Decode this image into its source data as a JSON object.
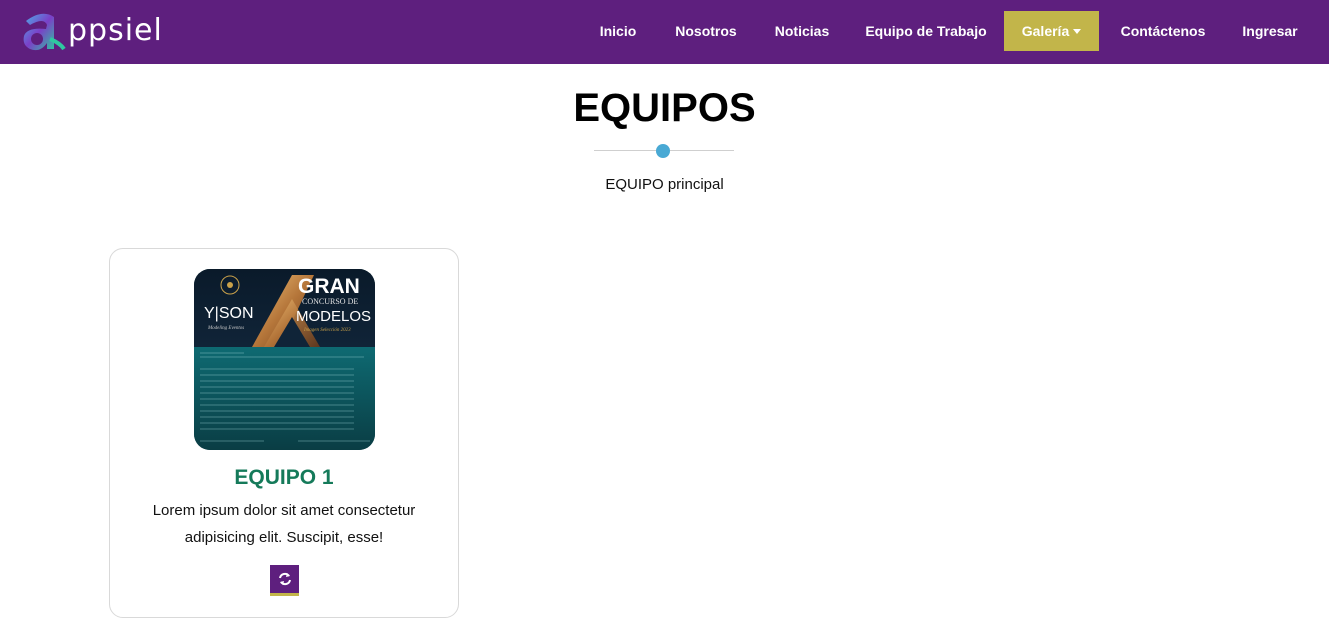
{
  "brand": {
    "logo_text": "ppsiel"
  },
  "nav": {
    "items": [
      {
        "label": "Inicio"
      },
      {
        "label": "Nosotros"
      },
      {
        "label": "Noticias"
      },
      {
        "label": "Equipo de Trabajo"
      },
      {
        "label": "Galería",
        "active": true
      },
      {
        "label": "Contáctenos"
      },
      {
        "label": "Ingresar"
      }
    ]
  },
  "section": {
    "title": "EQUIPOS",
    "subtitle": "EQUIPO principal"
  },
  "cards": [
    {
      "title": "EQUIPO 1",
      "description": "Lorem ipsum dolor sit amet consectetur adipisicing elit. Suscipit, esse!",
      "image": {
        "brand": "Y|SON",
        "brand_sub": "Modeling Eventos",
        "headline": "GRAN",
        "line2": "CONCURSO DE",
        "line3": "MODELOS",
        "line4": "Imagen Selección 2023"
      },
      "button_icon": "refresh-icon"
    }
  ],
  "colors": {
    "navbar": "#5e1f7e",
    "active_nav": "#c2b54a",
    "card_title": "#157a5a",
    "divider_dot": "#49a9d4"
  }
}
